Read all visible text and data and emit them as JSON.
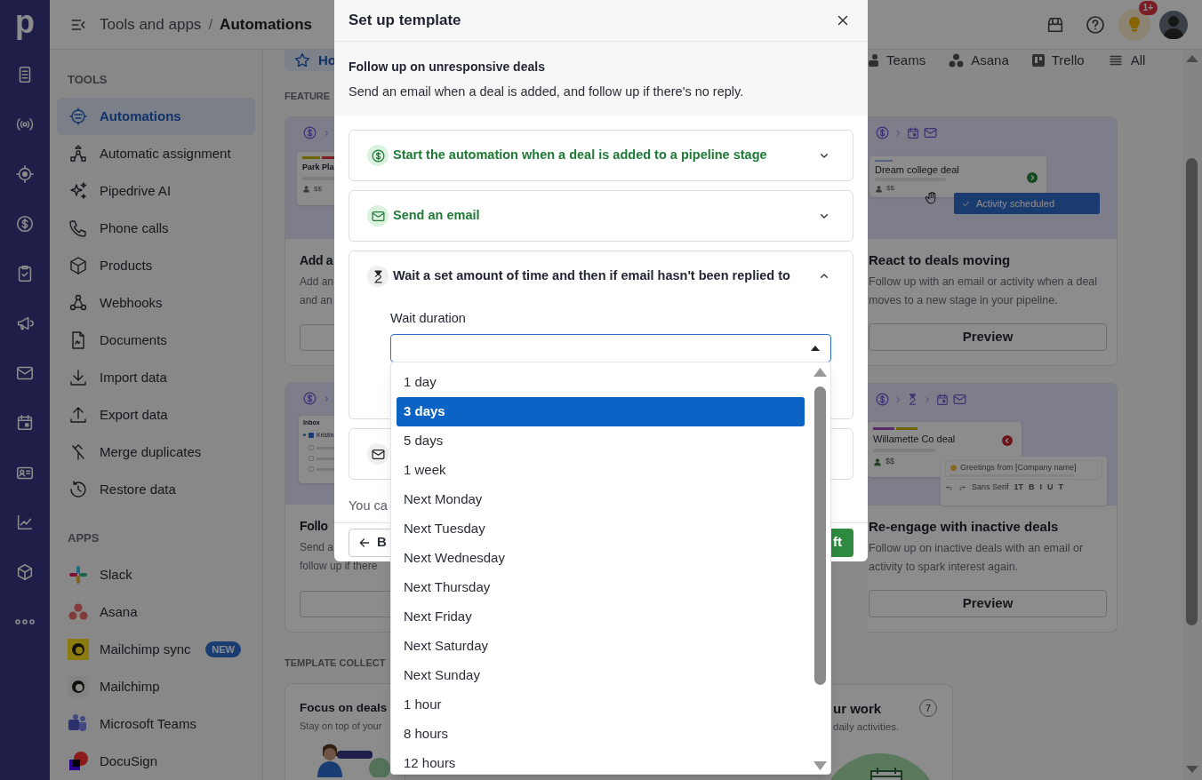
{
  "rail": {
    "logo": "p"
  },
  "topbar": {
    "breadcrumb_parent": "Tools and apps",
    "separator": "/",
    "breadcrumb_current": "Automations",
    "notification_badge": "1+"
  },
  "sidebar": {
    "sections": [
      {
        "heading": "TOOLS",
        "items": [
          {
            "label": "Automations",
            "selected": true
          },
          {
            "label": "Automatic assignment",
            "selected": false
          },
          {
            "label": "Pipedrive AI",
            "selected": false
          },
          {
            "label": "Phone calls",
            "selected": false
          },
          {
            "label": "Products",
            "selected": false
          },
          {
            "label": "Webhooks",
            "selected": false
          },
          {
            "label": "Documents",
            "selected": false
          },
          {
            "label": "Import data",
            "selected": false
          },
          {
            "label": "Export data",
            "selected": false
          },
          {
            "label": "Merge duplicates",
            "selected": false
          },
          {
            "label": "Restore data",
            "selected": false
          }
        ]
      },
      {
        "heading": "APPS",
        "items": [
          {
            "label": "Slack",
            "selected": false
          },
          {
            "label": "Asana",
            "selected": false
          },
          {
            "label": "Mailchimp sync",
            "selected": false,
            "badge": "NEW"
          },
          {
            "label": "Mailchimp",
            "selected": false
          },
          {
            "label": "Microsoft Teams",
            "selected": false
          },
          {
            "label": "DocuSign",
            "selected": false
          }
        ]
      }
    ]
  },
  "tabs": [
    {
      "label": "Ho",
      "selected": true
    },
    {
      "label": "Teams",
      "selected": false
    },
    {
      "label": "Asana",
      "selected": false
    },
    {
      "label": "Trello",
      "selected": false
    },
    {
      "label": "All",
      "selected": false
    }
  ],
  "featured": {
    "heading": "FEATURE",
    "left_cards": [
      {
        "preview_deal": "Park Pla",
        "preview_amount": "$$",
        "title": "Add a",
        "description": [
          "Add an",
          "and an"
        ]
      },
      {
        "preview_header": "Inbox",
        "preview_contact": "Kristin",
        "title": "Follo",
        "description": [
          "Send a",
          "follow up if there"
        ]
      }
    ],
    "right_cards": [
      {
        "preview_deal": "Dream college deal",
        "preview_amount": "$$",
        "preview_badge": "Activity scheduled",
        "title": "React to deals moving",
        "description": "Follow up with an email or activity when a deal moves to a new stage in your pipeline.",
        "button": "Preview"
      },
      {
        "preview_deal": "Willamette Co deal",
        "preview_amount": "$$",
        "email_greeting": "Greetings from [Company name]",
        "font_name": "Sans Serif",
        "toolbar_marks": [
          "1T",
          "B",
          "I",
          "U",
          "T"
        ],
        "title": "Re-engage with inactive deals",
        "description": "Follow up on inactive deals with an email or activity to spark interest again.",
        "button": "Preview"
      }
    ]
  },
  "collections": {
    "heading": "TEMPLATE COLLECT",
    "cards": [
      {
        "title": "Focus on deals",
        "description": "Stay on top of your"
      },
      {
        "title": "ur work",
        "description": "daily activities.",
        "count": "7"
      }
    ]
  },
  "modal": {
    "title": "Set up template",
    "template_name": "Follow up on unresponsive deals",
    "template_description": "Send an email when a deal is added, and follow up if there's no reply.",
    "steps": [
      {
        "kind": "trigger",
        "title": "Start the automation when a deal is added to a pipeline stage",
        "configured": true,
        "expanded": false
      },
      {
        "kind": "email",
        "title": "Send an email",
        "configured": true,
        "expanded": false
      },
      {
        "kind": "wait",
        "title": "Wait a set amount of time and then if email hasn't been replied to",
        "configured": false,
        "expanded": true,
        "field": {
          "label": "Wait duration",
          "open": true,
          "options": [
            {
              "label": "1 day",
              "selected": false
            },
            {
              "label": "3 days",
              "selected": true
            },
            {
              "label": "5 days",
              "selected": false
            },
            {
              "label": "1 week",
              "selected": false
            },
            {
              "label": "Next Monday",
              "selected": false
            },
            {
              "label": "Next Tuesday",
              "selected": false
            },
            {
              "label": "Next Wednesday",
              "selected": false
            },
            {
              "label": "Next Thursday",
              "selected": false
            },
            {
              "label": "Next Friday",
              "selected": false
            },
            {
              "label": "Next Saturday",
              "selected": false
            },
            {
              "label": "Next Sunday",
              "selected": false
            },
            {
              "label": "1 hour",
              "selected": false
            },
            {
              "label": "8 hours",
              "selected": false
            },
            {
              "label": "12 hours",
              "selected": false
            }
          ]
        }
      },
      {
        "kind": "email",
        "configured": false,
        "expanded": false
      }
    ],
    "note": "You ca",
    "back_button": "B",
    "primary_button": "ft"
  }
}
